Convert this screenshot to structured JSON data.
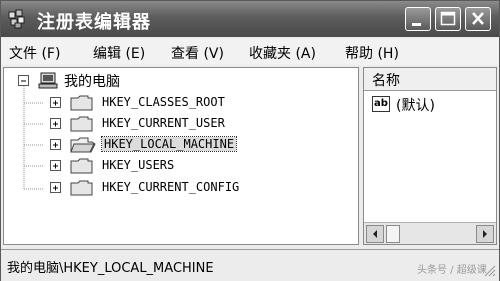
{
  "window": {
    "title": "注册表编辑器"
  },
  "menu": [
    {
      "label": "文件 (F)"
    },
    {
      "label": "编辑 (E)"
    },
    {
      "label": "查看 (V)"
    },
    {
      "label": "收藏夹 (A)"
    },
    {
      "label": "帮助 (H)"
    }
  ],
  "tree": {
    "root": {
      "label": "我的电脑",
      "icon": "computer-icon"
    },
    "keys": [
      {
        "label": "HKEY_CLASSES_ROOT",
        "icon": "folder-icon",
        "selected": false
      },
      {
        "label": "HKEY_CURRENT_USER",
        "icon": "folder-icon",
        "selected": false
      },
      {
        "label": "HKEY_LOCAL_MACHINE",
        "icon": "folder-open-icon",
        "selected": true
      },
      {
        "label": "HKEY_USERS",
        "icon": "folder-icon",
        "selected": false
      },
      {
        "label": "HKEY_CURRENT_CONFIG",
        "icon": "folder-icon",
        "selected": false
      }
    ]
  },
  "list": {
    "column_name": "名称",
    "values": [
      {
        "label": "(默认)",
        "icon": "string-value-icon"
      }
    ]
  },
  "status": {
    "path": "我的电脑\\HKEY_LOCAL_MACHINE"
  },
  "watermark": "头条号 / 超级课"
}
